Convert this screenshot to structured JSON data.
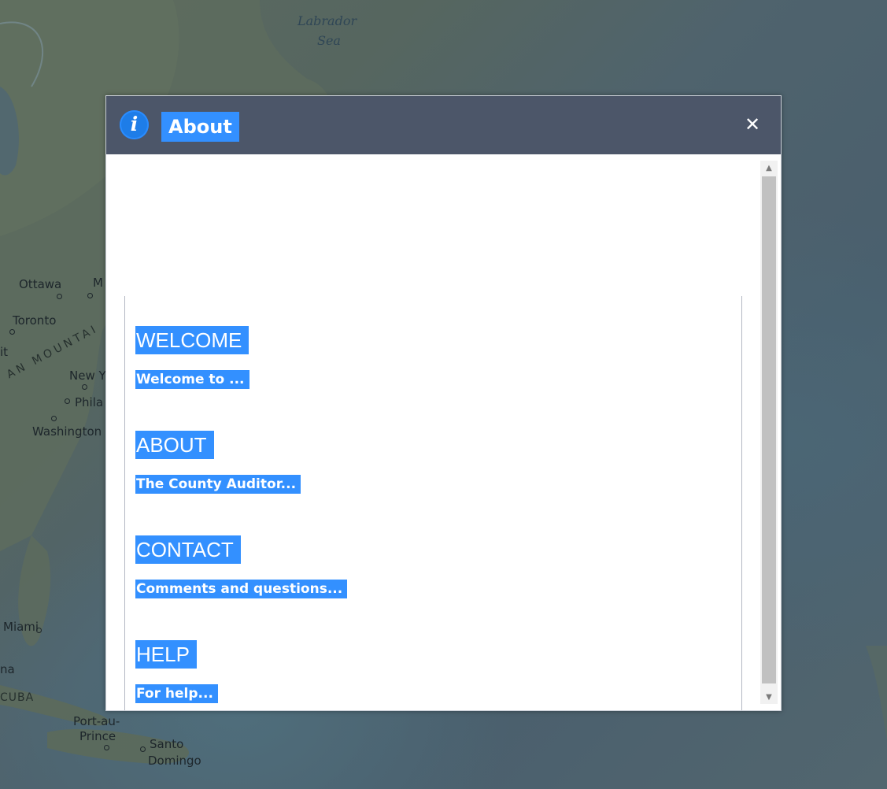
{
  "map": {
    "labels": {
      "labrador_sea": [
        "Labrador",
        "Sea"
      ],
      "ottawa": "Ottawa",
      "montreal_partial": "M",
      "toronto": "Toronto",
      "detroit_partial": "it",
      "mountains": "AN MOUNTAI",
      "new_york": "New Y",
      "philadelphia": "Phila",
      "washington": "Washington",
      "miami": "Miami",
      "havana_partial": "na",
      "cuba": "CUBA",
      "port_au_prince": [
        "Port-au-",
        "Prince"
      ],
      "santo_domingo": [
        "Santo",
        "Domingo"
      ]
    }
  },
  "dialog": {
    "title": "About",
    "icon": "info-icon",
    "close_symbol": "✕",
    "colors": {
      "header": "#4c5669",
      "selection": "#3390ff",
      "icon": "#1e7de8"
    },
    "sections": [
      {
        "heading": "WELCOME",
        "text": "Welcome to ..."
      },
      {
        "heading": "ABOUT",
        "text": "The County Auditor..."
      },
      {
        "heading": "CONTACT",
        "text": "Comments and questions..."
      },
      {
        "heading": "HELP",
        "text": "For help..."
      }
    ],
    "scrollbar": {
      "up_symbol": "▲",
      "down_symbol": "▼"
    }
  }
}
